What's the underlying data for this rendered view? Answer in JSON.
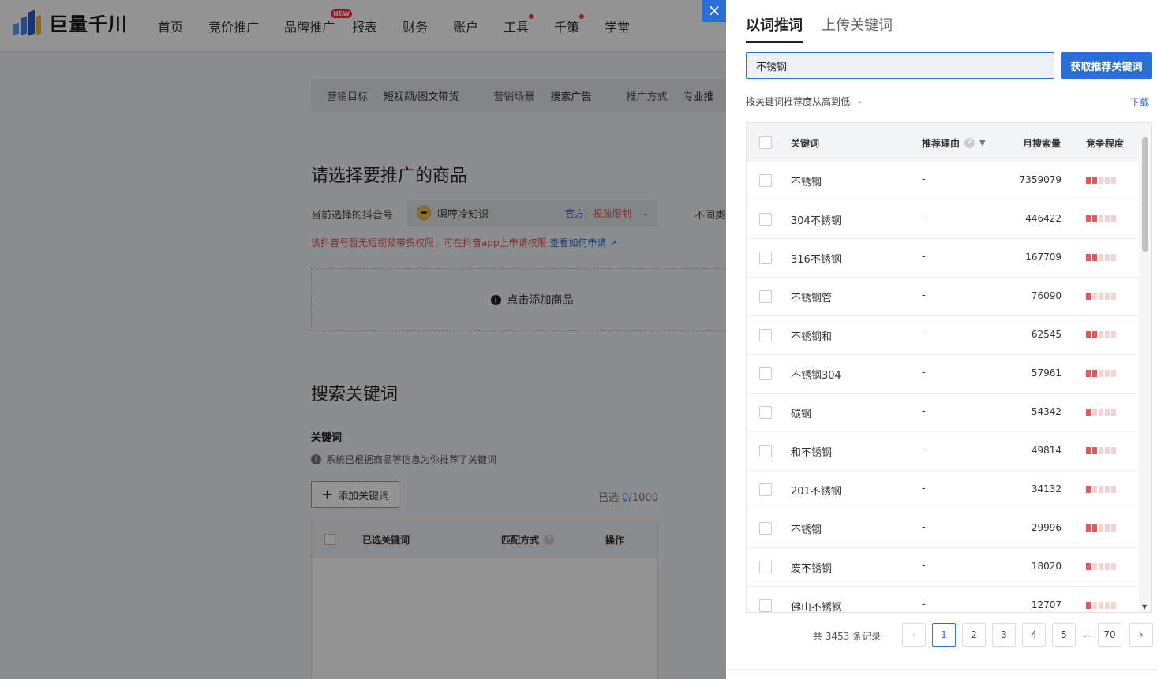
{
  "app": {
    "logo_text": "巨量千川",
    "nav": [
      {
        "label": "首页"
      },
      {
        "label": "竞价推广"
      },
      {
        "label": "品牌推广",
        "badge": "NEW"
      },
      {
        "label": "报表"
      },
      {
        "label": "财务"
      },
      {
        "label": "账户"
      },
      {
        "label": "工具",
        "dot": true
      },
      {
        "label": "千策",
        "dot": true
      },
      {
        "label": "学堂"
      }
    ],
    "steps": {
      "goal_label": "营销目标",
      "goal_value": "短视频/图文带货",
      "scene_label": "营销场景",
      "scene_value": "搜索广告",
      "method_label": "推广方式",
      "method_value": "专业推"
    },
    "product": {
      "title": "请选择要推广的商品",
      "account_label": "当前选择的抖音号",
      "account_name": "嗯哼冷知识",
      "tag_official": "官方",
      "tag_limit": "投放限制",
      "diff_label": "不同类",
      "warning": "该抖音号暂无短视频带货权限，可在抖音app上申请权限",
      "warning_link": "查看如何申请",
      "add_product": "点击添加商品"
    },
    "keywords": {
      "title": "搜索关键词",
      "label": "关键词",
      "hint": "系统已根据商品等信息为你推荐了关键词",
      "add_button": "添加关键词",
      "selected_prefix": "已选",
      "selected_count": "0",
      "selected_total": "/1000",
      "table_headers": [
        "已选关键词",
        "匹配方式",
        "操作"
      ]
    }
  },
  "drawer": {
    "close": "×",
    "tabs": [
      "以词推词",
      "上传关键词"
    ],
    "input_value": "不锈钢",
    "fetch_button": "获取推荐关键词",
    "sort_label": "按关键词推荐度从高到低",
    "download": "下载",
    "headers": {
      "keyword": "关键词",
      "reason": "推荐理由",
      "volume": "月搜索量",
      "competition": "竞争程度"
    },
    "rows": [
      {
        "keyword": "不锈钢",
        "reason": "-",
        "volume": "7359079",
        "level": 2
      },
      {
        "keyword": "304不锈钢",
        "reason": "-",
        "volume": "446422",
        "level": 2
      },
      {
        "keyword": "316不锈钢",
        "reason": "-",
        "volume": "167709",
        "level": 2
      },
      {
        "keyword": "不锈钢管",
        "reason": "-",
        "volume": "76090",
        "level": 1
      },
      {
        "keyword": "不锈钢和",
        "reason": "-",
        "volume": "62545",
        "level": 2
      },
      {
        "keyword": "不锈钢304",
        "reason": "-",
        "volume": "57961",
        "level": 2
      },
      {
        "keyword": "碳钢",
        "reason": "-",
        "volume": "54342",
        "level": 1
      },
      {
        "keyword": "和不锈钢",
        "reason": "-",
        "volume": "49814",
        "level": 2
      },
      {
        "keyword": "201不锈钢",
        "reason": "-",
        "volume": "34132",
        "level": 1
      },
      {
        "keyword": "不锈钢",
        "reason": "-",
        "volume": "29996",
        "level": 2
      },
      {
        "keyword": "废不锈钢",
        "reason": "-",
        "volume": "18020",
        "level": 1
      },
      {
        "keyword": "佛山不锈钢",
        "reason": "-",
        "volume": "12707",
        "level": 1
      }
    ],
    "pager": {
      "total": "共 3453 条记录",
      "pages": [
        "1",
        "2",
        "3",
        "4",
        "5"
      ],
      "ellipsis": "...",
      "last": "70"
    }
  },
  "colors": {
    "accent": "#2a6fd6",
    "danger": "#e65454",
    "bar_on": "#e05a5a",
    "bar_off": "#f6d3d3"
  }
}
